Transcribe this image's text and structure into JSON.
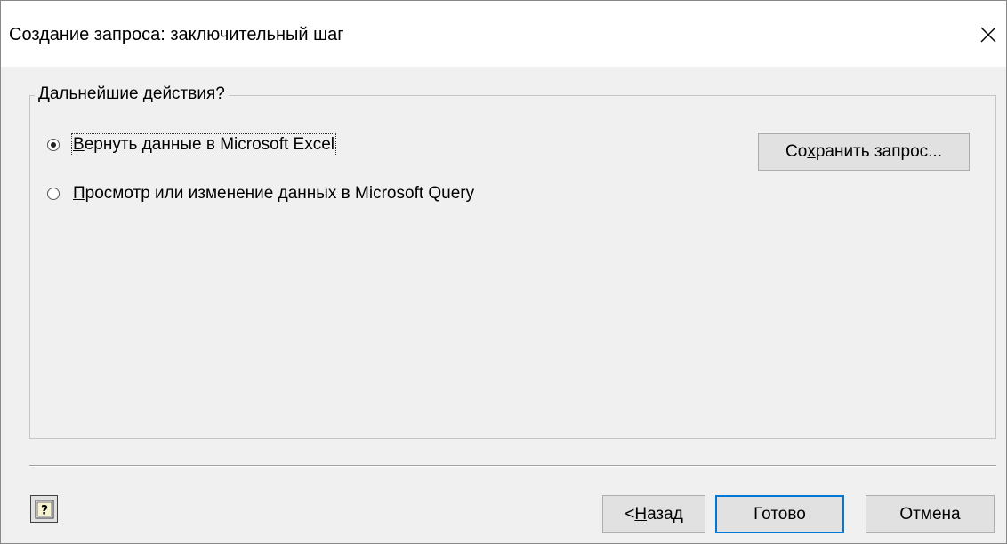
{
  "window": {
    "title": "Создание запроса: заключительный шаг"
  },
  "group": {
    "legend": "Дальнейшие действия?"
  },
  "options": [
    {
      "pre": "",
      "key": "В",
      "post": "ернуть данные в Microsoft Excel",
      "checked": true
    },
    {
      "pre": "",
      "key": "П",
      "post": "росмотр или изменение данных в Microsoft Query",
      "checked": false
    }
  ],
  "buttons": {
    "save_pre": "Со",
    "save_key": "х",
    "save_post": "ранить запрос...",
    "back_pre": "< ",
    "back_key": "Н",
    "back_post": "азад",
    "finish": "Готово",
    "cancel": "Отмена"
  },
  "icons": {
    "close": "close-icon",
    "help": "help-icon"
  },
  "colors": {
    "accent": "#0078d7",
    "background": "#f0f0f0",
    "titlebar": "#ffffff"
  }
}
